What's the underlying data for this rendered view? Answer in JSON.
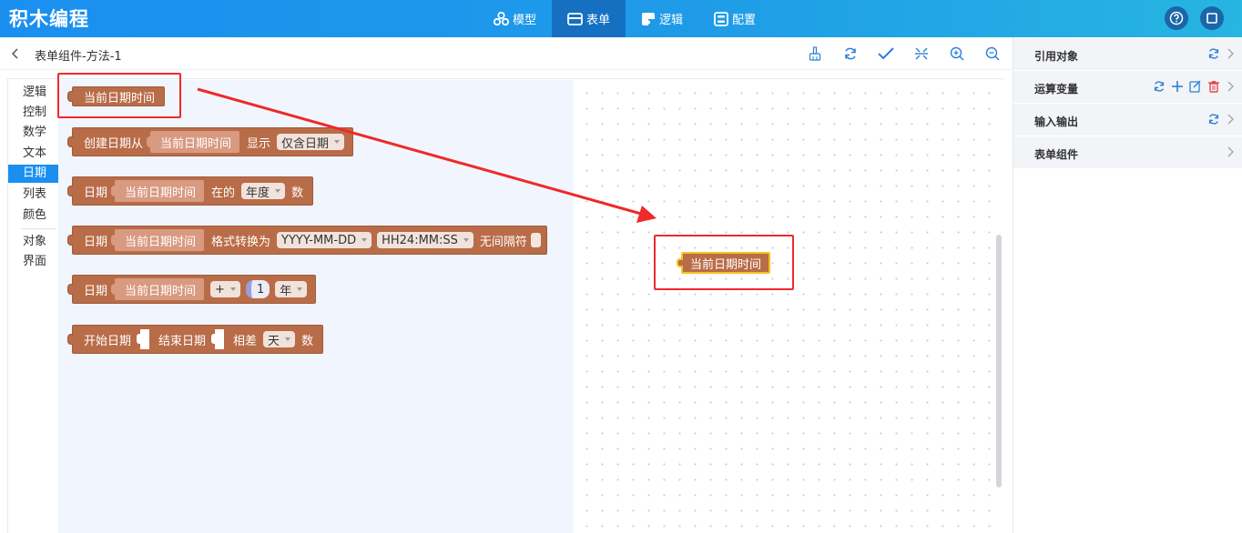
{
  "app": {
    "title": "积木编程"
  },
  "nav": [
    {
      "label": "模型",
      "icon": "model-cubes-icon"
    },
    {
      "label": "表单",
      "icon": "form-card-icon",
      "active": true
    },
    {
      "label": "逻辑",
      "icon": "logic-puzzle-icon"
    },
    {
      "label": "配置",
      "icon": "config-toggle-icon"
    }
  ],
  "header_actions": [
    "help-icon",
    "fullscreen-icon"
  ],
  "breadcrumb": {
    "title": "表单组件-方法-1"
  },
  "toolbar": [
    "clean-icon",
    "refresh-icon",
    "check-icon",
    "collapse-icon",
    "zoom-in-icon",
    "zoom-out-icon"
  ],
  "toolbox": {
    "categories": [
      "逻辑",
      "控制",
      "数学",
      "文本",
      "日期",
      "列表",
      "颜色",
      "对象",
      "界面"
    ],
    "active": "日期"
  },
  "blocks": {
    "b1": {
      "text": "当前日期时间"
    },
    "b2": {
      "t1": "创建日期从",
      "slot": "当前日期时间",
      "t2": "显示",
      "dd": "仅含日期"
    },
    "b3": {
      "t1": "日期",
      "slot": "当前日期时间",
      "t2": "在的",
      "dd": "年度",
      "t3": "数"
    },
    "b4": {
      "t1": "日期",
      "slot": "当前日期时间",
      "t2": "格式转换为",
      "dd1": "YYYY-MM-DD",
      "dd2": "HH24:MM:SS",
      "t3": "无间隔符"
    },
    "b5": {
      "t1": "日期",
      "slot": "当前日期时间",
      "dd1": "+",
      "num": "1",
      "dd2": "年"
    },
    "b6": {
      "t1": "开始日期",
      "t2": "结束日期",
      "t3": "相差",
      "dd": "天",
      "t4": "数"
    }
  },
  "canvas": {
    "block_text": "当前日期时间"
  },
  "colors": {
    "block": "#b96c48",
    "highlight": "#ee2a2a",
    "accent": "#1a8ff0"
  },
  "right_panel": [
    {
      "label": "引用对象",
      "icons": [
        "refresh-icon",
        "chevron-right-icon"
      ]
    },
    {
      "label": "运算变量",
      "icons": [
        "refresh-icon",
        "plus-icon",
        "edit-icon",
        "delete-icon",
        "chevron-right-icon"
      ]
    },
    {
      "label": "输入输出",
      "icons": [
        "refresh-icon",
        "chevron-right-icon"
      ]
    },
    {
      "label": "表单组件",
      "icons": [
        "chevron-right-icon"
      ]
    }
  ]
}
